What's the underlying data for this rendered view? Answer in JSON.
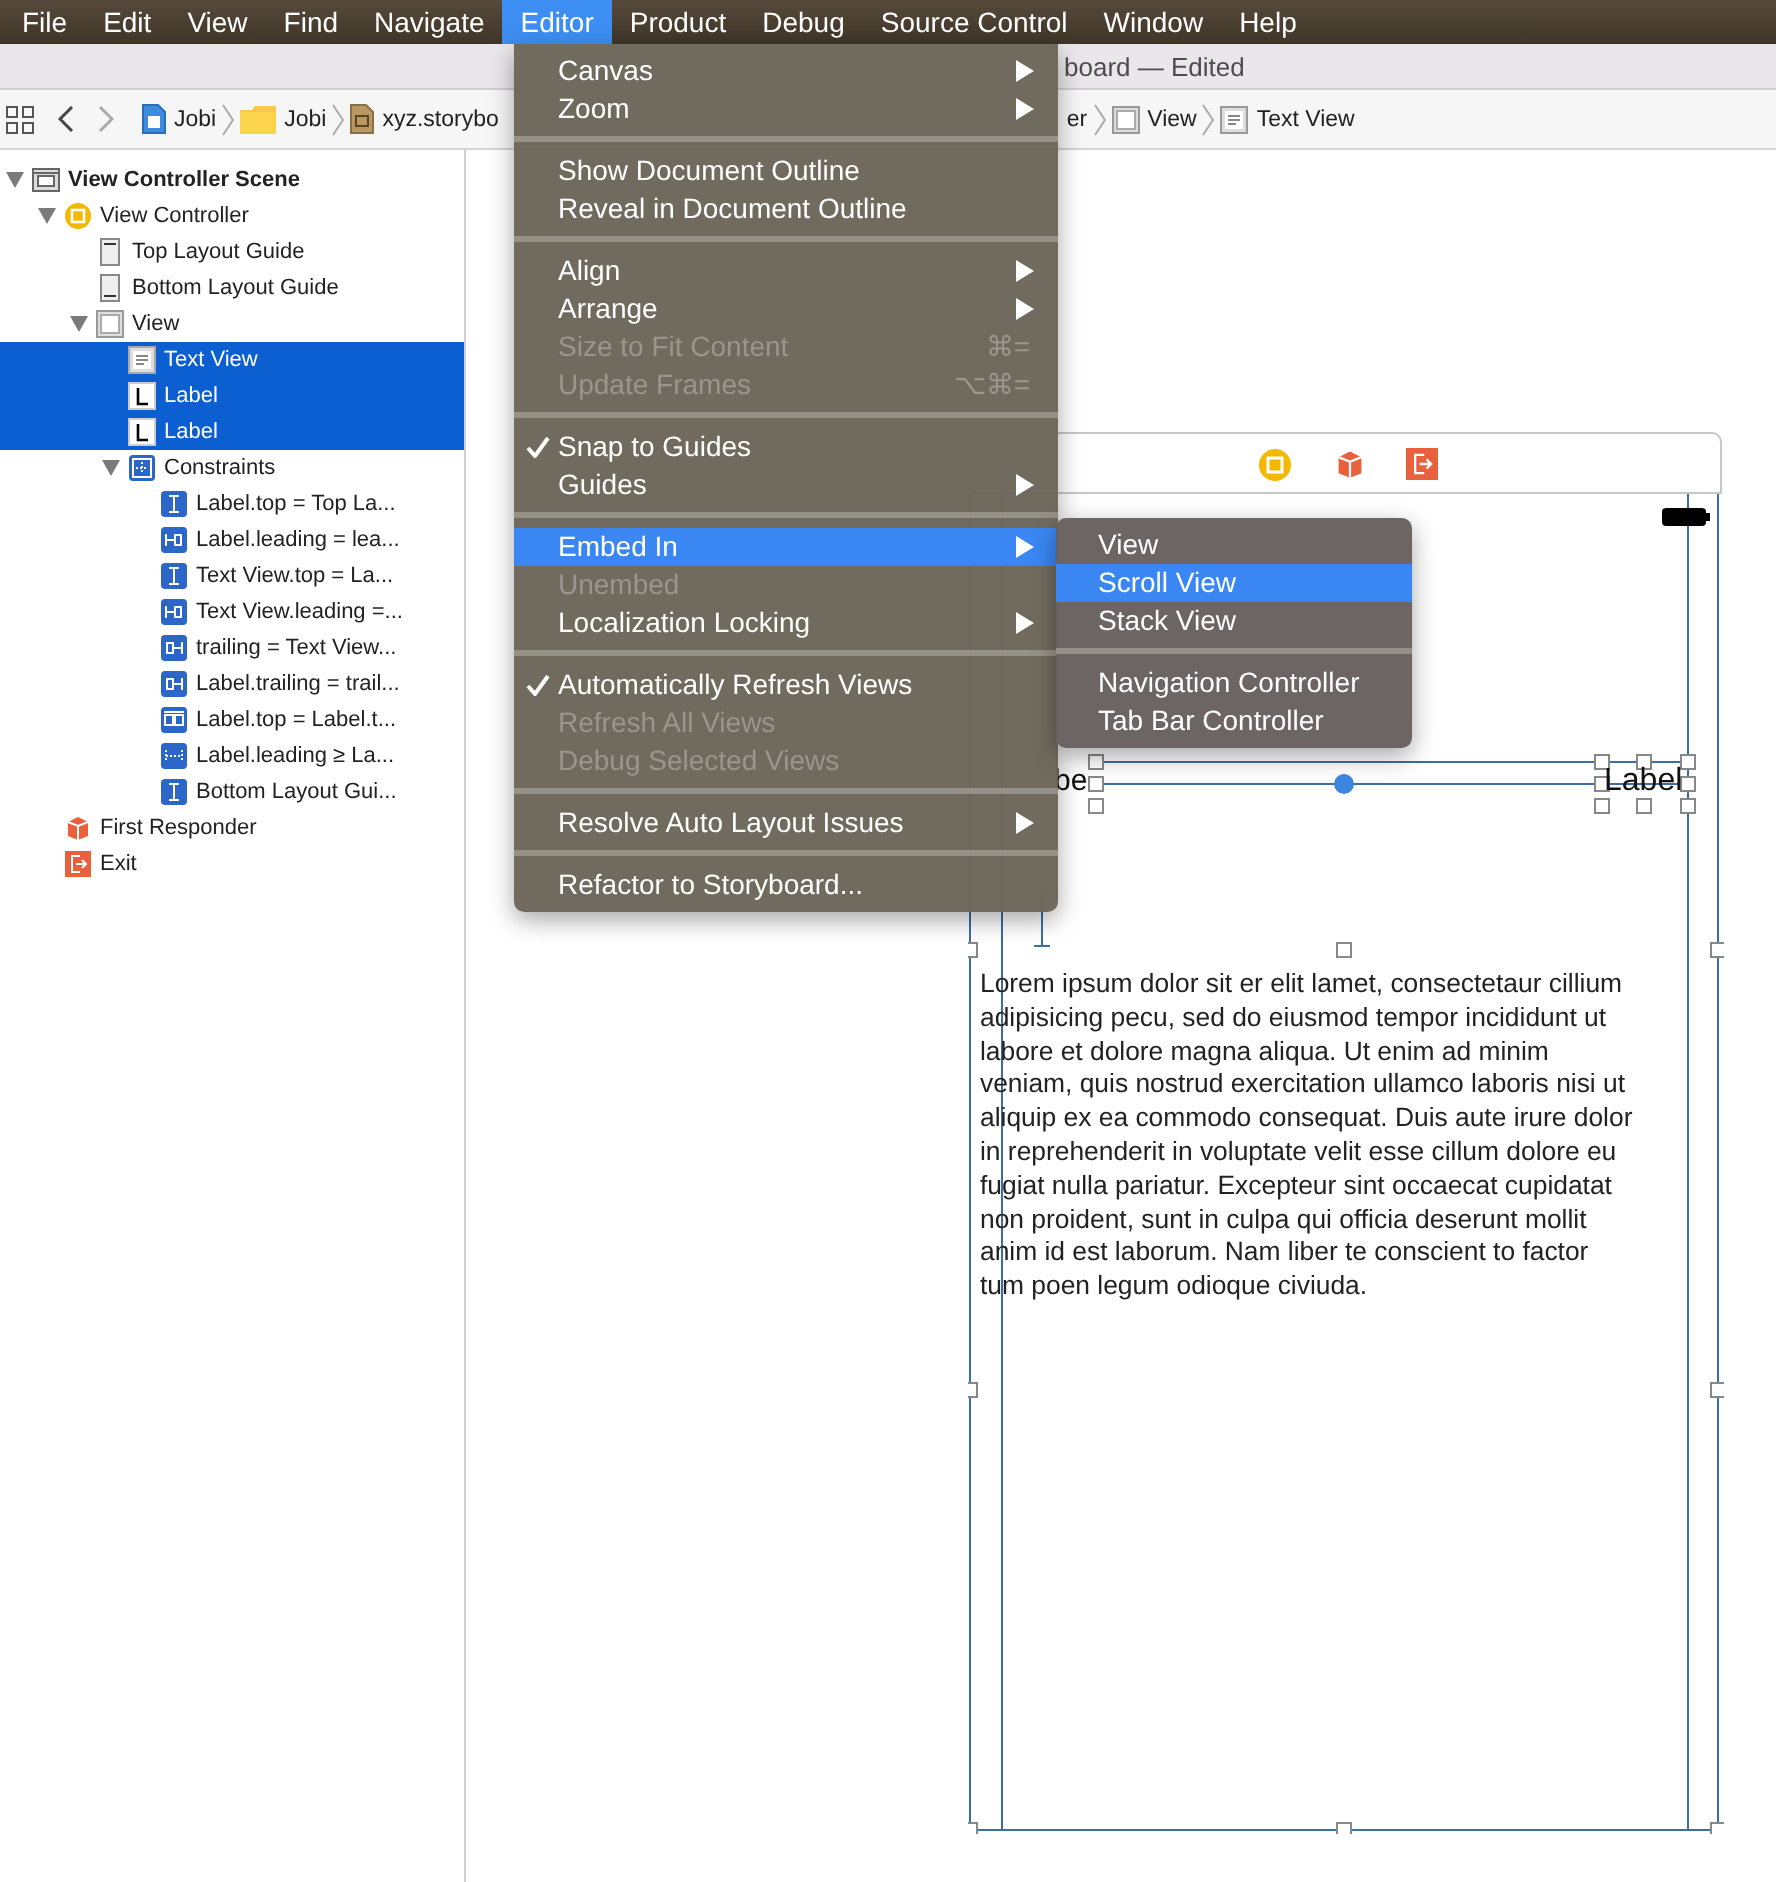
{
  "menubar": {
    "items": [
      {
        "label": "File",
        "selected": false
      },
      {
        "label": "Edit",
        "selected": false
      },
      {
        "label": "View",
        "selected": false
      },
      {
        "label": "Find",
        "selected": false
      },
      {
        "label": "Navigate",
        "selected": false
      },
      {
        "label": "Editor",
        "selected": true
      },
      {
        "label": "Product",
        "selected": false
      },
      {
        "label": "Debug",
        "selected": false
      },
      {
        "label": "Source Control",
        "selected": false
      },
      {
        "label": "Window",
        "selected": false
      },
      {
        "label": "Help",
        "selected": false
      }
    ]
  },
  "window": {
    "title": "board — Edited"
  },
  "breadcrumb": {
    "items": [
      {
        "label": "Jobi",
        "kind": "project"
      },
      {
        "label": "Jobi",
        "kind": "folder"
      },
      {
        "label": "xyz.storybo",
        "kind": "storyboard"
      }
    ],
    "trailing": [
      {
        "label": "er",
        "kind": "none"
      },
      {
        "label": "View",
        "kind": "view"
      },
      {
        "label": "Text View",
        "kind": "textview"
      }
    ]
  },
  "outline": {
    "items": [
      {
        "label": "View Controller Scene",
        "kind": "scene",
        "bold": true,
        "selected": false,
        "expanded": true,
        "children": [
          {
            "label": "View Controller",
            "kind": "controller",
            "selected": false,
            "expanded": true,
            "children": [
              {
                "label": "Top Layout Guide",
                "kind": "guide-top",
                "selected": false
              },
              {
                "label": "Bottom Layout Guide",
                "kind": "guide-bottom",
                "selected": false
              },
              {
                "label": "View",
                "kind": "view",
                "selected": false,
                "expanded": true,
                "children": [
                  {
                    "label": "Text View",
                    "kind": "textview",
                    "selected": true
                  },
                  {
                    "label": "Label",
                    "kind": "label",
                    "selected": true
                  },
                  {
                    "label": "Label",
                    "kind": "label",
                    "selected": true
                  },
                  {
                    "label": "Constraints",
                    "kind": "constraints",
                    "selected": false,
                    "expanded": true,
                    "children": [
                      {
                        "label": "Label.top = Top La...",
                        "kind": "c-vertical",
                        "selected": false
                      },
                      {
                        "label": "Label.leading = lea...",
                        "kind": "c-leading",
                        "selected": false
                      },
                      {
                        "label": "Text View.top = La...",
                        "kind": "c-vertical",
                        "selected": false
                      },
                      {
                        "label": "Text View.leading =...",
                        "kind": "c-leading",
                        "selected": false
                      },
                      {
                        "label": "trailing = Text View...",
                        "kind": "c-trailing",
                        "selected": false
                      },
                      {
                        "label": "Label.trailing = trail...",
                        "kind": "c-trailing",
                        "selected": false
                      },
                      {
                        "label": "Label.top = Label.t...",
                        "kind": "c-pair",
                        "selected": false
                      },
                      {
                        "label": "Label.leading ≥ La...",
                        "kind": "c-width",
                        "selected": false
                      },
                      {
                        "label": "Bottom Layout Gui...",
                        "kind": "c-vertical",
                        "selected": false
                      }
                    ]
                  }
                ]
              }
            ]
          },
          {
            "label": "First Responder",
            "kind": "responder",
            "selected": false
          },
          {
            "label": "Exit",
            "kind": "exit",
            "selected": false
          }
        ]
      }
    ]
  },
  "editor_menu": {
    "sections": [
      [
        {
          "label": "Canvas",
          "submenu": true
        },
        {
          "label": "Zoom",
          "submenu": true
        }
      ],
      [
        {
          "label": "Show Document Outline"
        },
        {
          "label": "Reveal in Document Outline"
        }
      ],
      [
        {
          "label": "Align",
          "submenu": true
        },
        {
          "label": "Arrange",
          "submenu": true
        },
        {
          "label": "Size to Fit Content",
          "shortcut": "⌘=",
          "disabled": true
        },
        {
          "label": "Update Frames",
          "shortcut": "⌥⌘=",
          "disabled": true
        }
      ],
      [
        {
          "label": "Snap to Guides",
          "checked": true
        },
        {
          "label": "Guides",
          "submenu": true
        }
      ],
      [
        {
          "label": "Embed In",
          "submenu": true,
          "selected": true
        },
        {
          "label": "Unembed",
          "disabled": true
        },
        {
          "label": "Localization Locking",
          "submenu": true
        }
      ],
      [
        {
          "label": "Automatically Refresh Views",
          "checked": true
        },
        {
          "label": "Refresh All Views",
          "disabled": true
        },
        {
          "label": "Debug Selected Views",
          "disabled": true
        }
      ],
      [
        {
          "label": "Resolve Auto Layout Issues",
          "submenu": true
        }
      ],
      [
        {
          "label": "Refactor to Storyboard..."
        }
      ]
    ]
  },
  "embed_submenu": {
    "sections": [
      [
        {
          "label": "View",
          "selected": false
        },
        {
          "label": "Scroll View",
          "selected": true
        },
        {
          "label": "Stack View",
          "selected": false
        }
      ],
      [
        {
          "label": "Navigation Controller",
          "selected": false
        },
        {
          "label": "Tab Bar Controller",
          "selected": false
        }
      ]
    ]
  },
  "canvas": {
    "labels": [
      {
        "text": "be"
      },
      {
        "text": "Label"
      }
    ],
    "text_view": "Lorem ipsum dolor sit er elit lamet, consectetaur cillium\nadipisicing pecu, sed do eiusmod tempor incididunt ut\nlabore et dolore magna aliqua. Ut enim ad minim\nveniam, quis nostrud exercitation ullamco laboris nisi ut\naliquip ex ea commodo consequat. Duis aute irure dolor\nin reprehenderit in voluptate velit esse cillum dolore eu\nfugiat nulla pariatur. Excepteur sint occaecat cupidatat\nnon proident, sunt in culpa qui officia deserunt mollit\nanim id est laborum. Nam liber te conscient to factor\ntum poen legum odioque civiuda."
  }
}
